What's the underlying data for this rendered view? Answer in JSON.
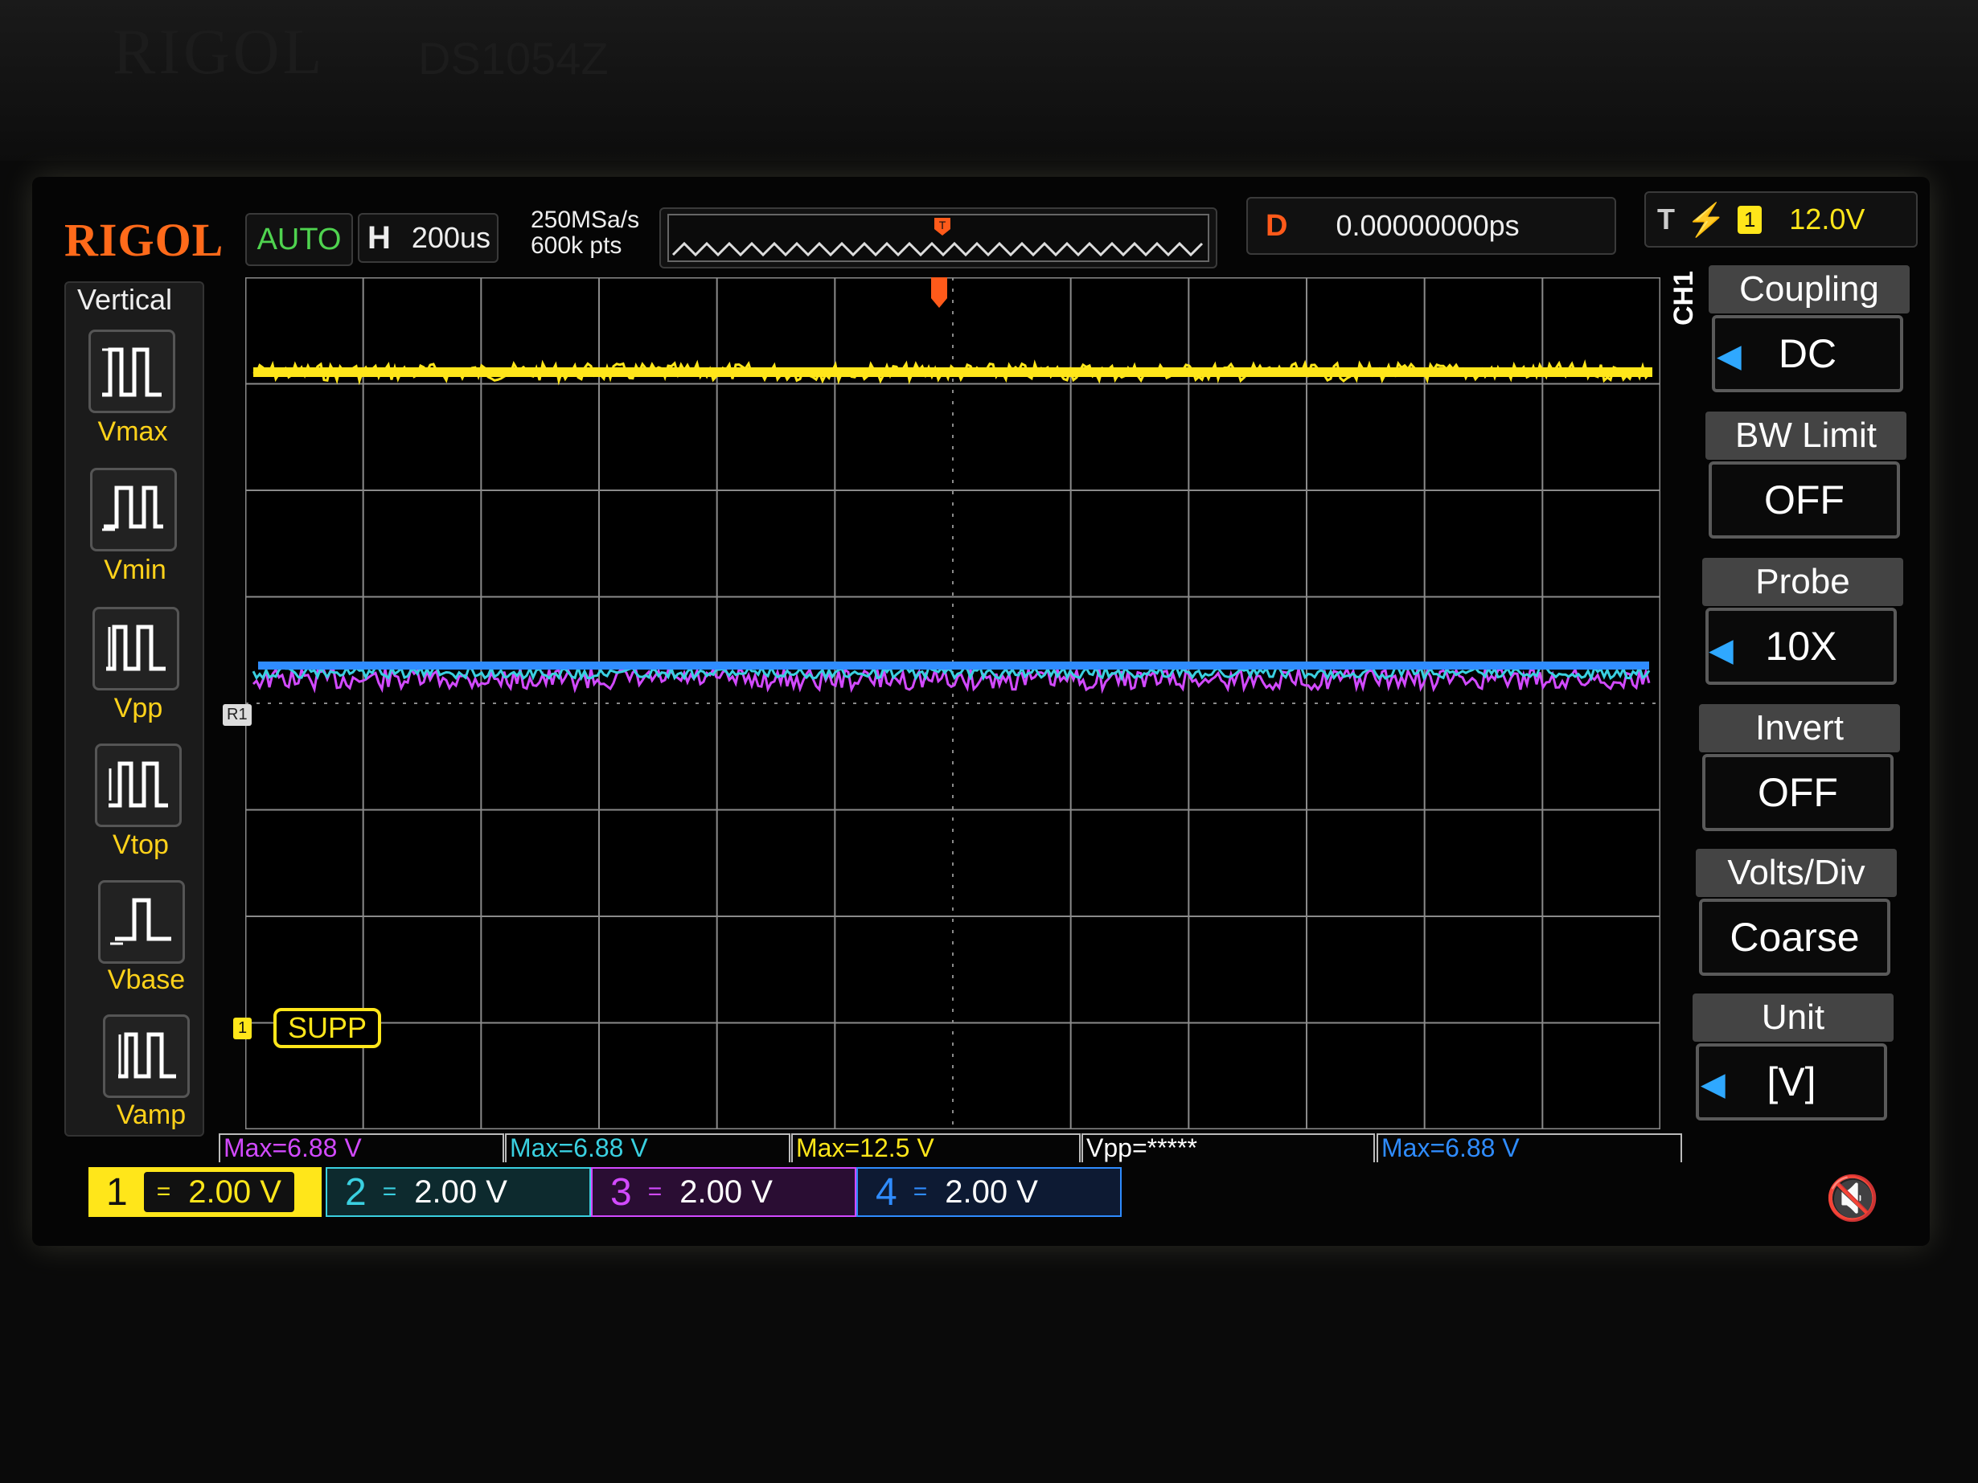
{
  "bezel": {
    "brand": "RIGOL",
    "model": "DS1054Z"
  },
  "header": {
    "logo": "RIGOL",
    "run_state": "AUTO",
    "timebase_label": "H",
    "timebase_value": "200us",
    "sample_rate": "250MSa/s",
    "memory_depth": "600k pts",
    "delay_label": "D",
    "delay_value": "0.00000000ps",
    "trigger_label": "T",
    "trigger_channel": "1",
    "trigger_level": "12.0V"
  },
  "vertical_menu": {
    "title": "Vertical",
    "items": [
      {
        "label": "Vmax",
        "icon": "vmax-icon"
      },
      {
        "label": "Vmin",
        "icon": "vmin-icon"
      },
      {
        "label": "Vpp",
        "icon": "vpp-icon"
      },
      {
        "label": "Vtop",
        "icon": "vtop-icon"
      },
      {
        "label": "Vbase",
        "icon": "vbase-icon"
      },
      {
        "label": "Vamp",
        "icon": "vamp-icon"
      }
    ]
  },
  "waveform": {
    "channel_tag": "CH1",
    "ref_marker": "R1",
    "supp_marker_num": "1",
    "supp_label": "SUPP",
    "trigger_marker": "T"
  },
  "right_menu": {
    "items": [
      {
        "header": "Coupling",
        "value": "DC",
        "arrow": true
      },
      {
        "header": "BW Limit",
        "value": "OFF",
        "arrow": false
      },
      {
        "header": "Probe",
        "value": "10X",
        "arrow": true
      },
      {
        "header": "Invert",
        "value": "OFF",
        "arrow": false
      },
      {
        "header": "Volts/Div",
        "value": "Coarse",
        "arrow": false
      },
      {
        "header": "Unit",
        "value": "[V]",
        "arrow": true
      }
    ]
  },
  "measurements": [
    {
      "text": "Max=6.88 V",
      "color": "#d24aff"
    },
    {
      "text": "Max=6.88 V",
      "color": "#3ad0e0"
    },
    {
      "text": "Max=12.5 V",
      "color": "#ffe61a"
    },
    {
      "text": "Vpp=*****",
      "color": "#ffffff"
    },
    {
      "text": "Max=6.88 V",
      "color": "#2f8cff"
    }
  ],
  "channels": [
    {
      "num": "1",
      "coupling": "=",
      "scale": "2.00 V",
      "color": "#ffe61a"
    },
    {
      "num": "2",
      "coupling": "=",
      "scale": "2.00 V",
      "color": "#3ad0e0"
    },
    {
      "num": "3",
      "coupling": "=",
      "scale": "2.00 V",
      "color": "#d24aff"
    },
    {
      "num": "4",
      "coupling": "=",
      "scale": "2.00 V",
      "color": "#2f8cff"
    }
  ],
  "colors": {
    "ch1": "#ffe61a",
    "ch2": "#3ad0e0",
    "ch3": "#d24aff",
    "ch4": "#2f8cff",
    "accent": "#ff6a1a"
  },
  "mute_icon": "speaker-mute-icon"
}
